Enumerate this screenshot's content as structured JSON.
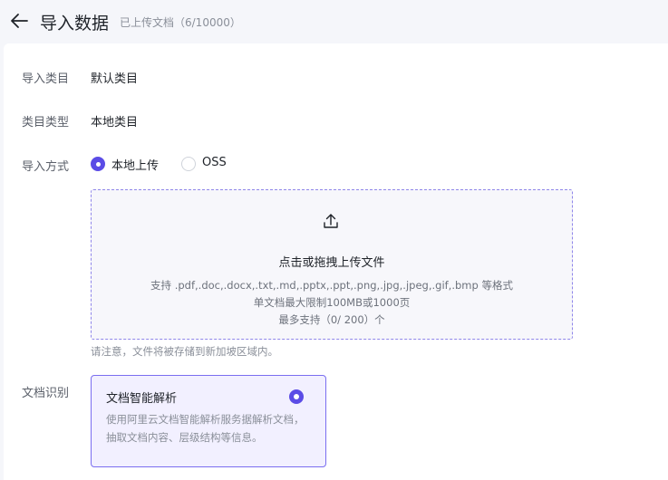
{
  "header": {
    "title": "导入数据",
    "subtitle": "已上传文档（6/10000）"
  },
  "form": {
    "category": {
      "label": "导入类目",
      "value": "默认类目"
    },
    "category_type": {
      "label": "类目类型",
      "value": "本地类目"
    },
    "import_method": {
      "label": "导入方式",
      "options": [
        {
          "label": "本地上传",
          "selected": true
        },
        {
          "label": "OSS",
          "selected": false
        }
      ]
    },
    "upload": {
      "icon": "upload-icon",
      "main_text": "点击或拖拽上传文件",
      "hint_formats": "支持 .pdf,.doc,.docx,.txt,.md,.pptx,.ppt,.png,.jpg,.jpeg,.gif,.bmp 等格式",
      "hint_limit": "单文档最大限制100MB或1000页",
      "hint_count": "最多支持（0/ 200）个"
    },
    "note": "请注意，文件将被存储到新加坡区域内。",
    "doc_recognition": {
      "label": "文档识别",
      "card_title": "文档智能解析",
      "card_desc": "使用阿里云文档智能解析服务据解析文档，抽取文档内容、层级结构等信息。",
      "selected": true
    }
  },
  "colors": {
    "accent": "#5b4ce6",
    "card_bg": "#f2f0ff",
    "dropzone_border": "#8f86ea"
  }
}
